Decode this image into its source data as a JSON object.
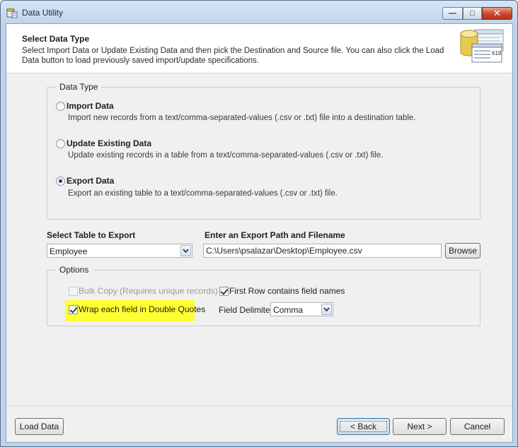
{
  "window": {
    "title": "Data Utility",
    "minimize_glyph": "—",
    "maximize_glyph": "□",
    "close_glyph": "✕"
  },
  "header": {
    "title": "Select Data Type",
    "description": "Select Import Data or Update Existing Data and then pick the Destination and Source file.  You can also click the Load Data button to load previously saved import/update specifications.",
    "icon": "database-table-icon",
    "icon_text": "618"
  },
  "data_type": {
    "legend": "Data Type",
    "options": [
      {
        "title": "Import Data",
        "description": "Import new records from a text/comma-separated-values (.csv or .txt) file into a destination table.",
        "checked": false
      },
      {
        "title": "Update Existing Data",
        "description": "Update existing records in a table from a text/comma-separated-values (.csv or .txt) file.",
        "checked": false
      },
      {
        "title": "Export Data",
        "description": "Export an existing table to a text/comma-separated-values (.csv or .txt) file.",
        "checked": true
      }
    ]
  },
  "export": {
    "table_label": "Select Table to Export",
    "table_value": "Employee",
    "path_label": "Enter an Export Path and Filename",
    "path_value": "C:\\Users\\psalazar\\Desktop\\Employee.csv",
    "browse_label": "Browse"
  },
  "options": {
    "legend": "Options",
    "bulk_copy_label": "Bulk Copy (Requires unique records)",
    "bulk_copy_checked": false,
    "wrap_quotes_label": "Wrap each field in Double Quotes",
    "wrap_quotes_checked": true,
    "first_row_label": "First Row contains field names",
    "first_row_checked": true,
    "delimiter_label": "Field Delimiter",
    "delimiter_value": "Comma"
  },
  "footer": {
    "load_label": "Load Data",
    "back_label": "< Back",
    "next_label": "Next >",
    "cancel_label": "Cancel"
  },
  "colors": {
    "highlight": "#ffff33",
    "accent": "#3c7fb1"
  }
}
